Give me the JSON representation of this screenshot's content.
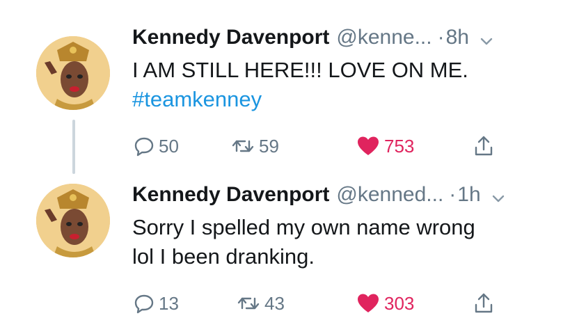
{
  "tweets": [
    {
      "name": "Kennedy Davenport",
      "handle": "@kenne...",
      "dot": "·",
      "time": "8h",
      "text": "I AM STILL HERE!!! LOVE ON ME.",
      "hashtag": "#teamkenney",
      "replies": "50",
      "retweets": "59",
      "likes": "753"
    },
    {
      "name": "Kennedy Davenport",
      "handle": "@kenned...",
      "dot": "·",
      "time": "1h",
      "text_line1": "Sorry I spelled my own name wrong",
      "text_line2": "lol I been dranking.",
      "replies": "13",
      "retweets": "43",
      "likes": "303"
    }
  ],
  "colors": {
    "like": "#e0245e",
    "link": "#1b95e0",
    "secondary": "#657786",
    "thread_line": "#ccd6dd"
  },
  "icons": {
    "reply": "reply-icon",
    "retweet": "retweet-icon",
    "like": "heart-icon",
    "share": "share-icon",
    "menu": "chevron-down-icon"
  }
}
